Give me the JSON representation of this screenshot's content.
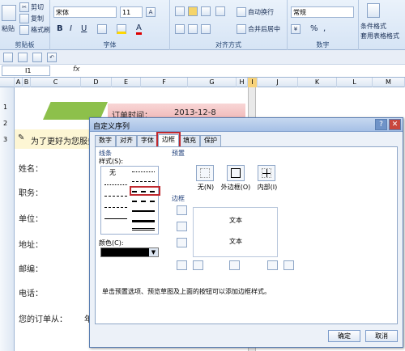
{
  "ribbon": {
    "clipboard": {
      "cut": "剪切",
      "copy": "复制",
      "format_painter": "格式刷",
      "paste": "粘贴",
      "label": "剪贴板"
    },
    "font": {
      "name": "宋体",
      "size": "11",
      "label": "字体",
      "bold": "B",
      "italic": "I",
      "underline": "U",
      "color_a": "A"
    },
    "alignment": {
      "wrap": "自动换行",
      "merge": "合并后居中",
      "label": "对齐方式"
    },
    "number": {
      "format": "常规",
      "percent": "%",
      "comma": ",",
      "label": "数字"
    },
    "styles": {
      "conditional": "条件格式",
      "table": "套用表格格式"
    }
  },
  "formula_bar": {
    "cell_ref": "I1",
    "fx": "fx"
  },
  "columns": [
    "A",
    "B",
    "C",
    "D",
    "E",
    "F",
    "G",
    "H",
    "I",
    "J",
    "K",
    "L",
    "M"
  ],
  "rows": [
    "1",
    "2",
    "3"
  ],
  "sheet": {
    "order_time_label": "订单时间：",
    "order_date": "2013-12-8",
    "notice": "为了更好为您服务",
    "name": "姓名：",
    "job": "职务：",
    "unit": "单位：",
    "address": "地址：",
    "post": "邮编：",
    "phone": "电话：",
    "order_from": "您的订单从：",
    "year_fragment": "年"
  },
  "dialog": {
    "title": "自定义序列",
    "help": "?",
    "close": "✕",
    "tabs": [
      "数字",
      "对齐",
      "字体",
      "边框",
      "填充",
      "保护"
    ],
    "active_tab": "边框",
    "line_section": "线条",
    "style_label": "样式(S):",
    "none_style": "无",
    "color_label": "颜色(C):",
    "preset_section": "预置",
    "preset_none": "无(N)",
    "preset_outline": "外边框(O)",
    "preset_inside": "内部(I)",
    "border_section": "边框",
    "preview_text_1": "文本",
    "preview_text_2": "文本",
    "hint": "单击预置选项、预览草图及上面的按钮可以添加边框样式。",
    "ok": "确定",
    "cancel": "取消"
  },
  "colors": {
    "accent_red": "#c0282e",
    "title_bar": "#a6c0e6",
    "ribbon": "#d6e4f5"
  }
}
